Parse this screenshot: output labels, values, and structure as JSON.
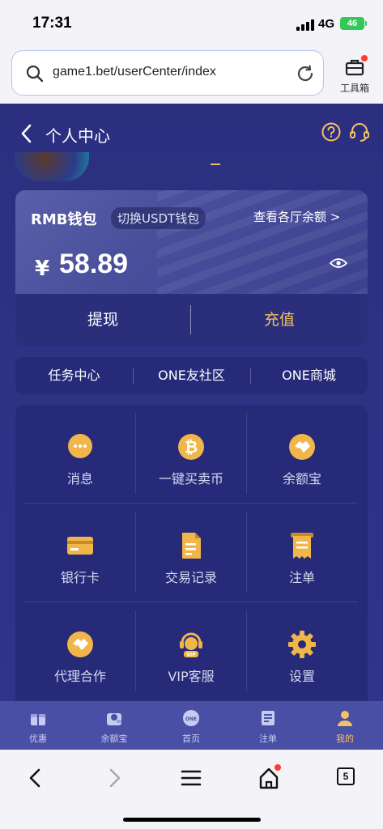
{
  "status_bar": {
    "time": "17:31",
    "network": "4G",
    "battery": "46"
  },
  "browser": {
    "url": "game1.bet/userCenter/index",
    "tools_label": "工具箱",
    "tab_count": "5"
  },
  "header": {
    "title": "个人中心"
  },
  "wallet": {
    "name": "RMB钱包",
    "switch_label": "切换USDT钱包",
    "view_all": "查看各厅余额 >",
    "currency_symbol": "¥",
    "balance": "58.89",
    "withdraw_label": "提现",
    "deposit_label": "充值",
    "deposit_color": "#f2c265"
  },
  "links": [
    "任务中心",
    "ONE友社区",
    "ONE商城"
  ],
  "grid": [
    {
      "label": "消息",
      "icon": "message-icon"
    },
    {
      "label": "一键买卖币",
      "icon": "bitcoin-icon"
    },
    {
      "label": "余额宝",
      "icon": "handshake-icon"
    },
    {
      "label": "银行卡",
      "icon": "bank-card-icon"
    },
    {
      "label": "交易记录",
      "icon": "transaction-doc-icon"
    },
    {
      "label": "注单",
      "icon": "bet-slip-icon"
    },
    {
      "label": "代理合作",
      "icon": "handshake-icon"
    },
    {
      "label": "VIP客服",
      "icon": "vip-headset-icon"
    },
    {
      "label": "设置",
      "icon": "gear-icon"
    }
  ],
  "tabbar": [
    {
      "label": "优惠",
      "icon": "gift-icon"
    },
    {
      "label": "余额宝",
      "icon": "wallet-icon"
    },
    {
      "label": "首页",
      "icon": "home-ball-icon"
    },
    {
      "label": "注单",
      "icon": "document-icon"
    },
    {
      "label": "我的",
      "icon": "user-icon",
      "active": true
    }
  ],
  "colors": {
    "page_bg": "#2e3285",
    "accent_gold": "#f2c265",
    "card_bg": "#262a78"
  }
}
